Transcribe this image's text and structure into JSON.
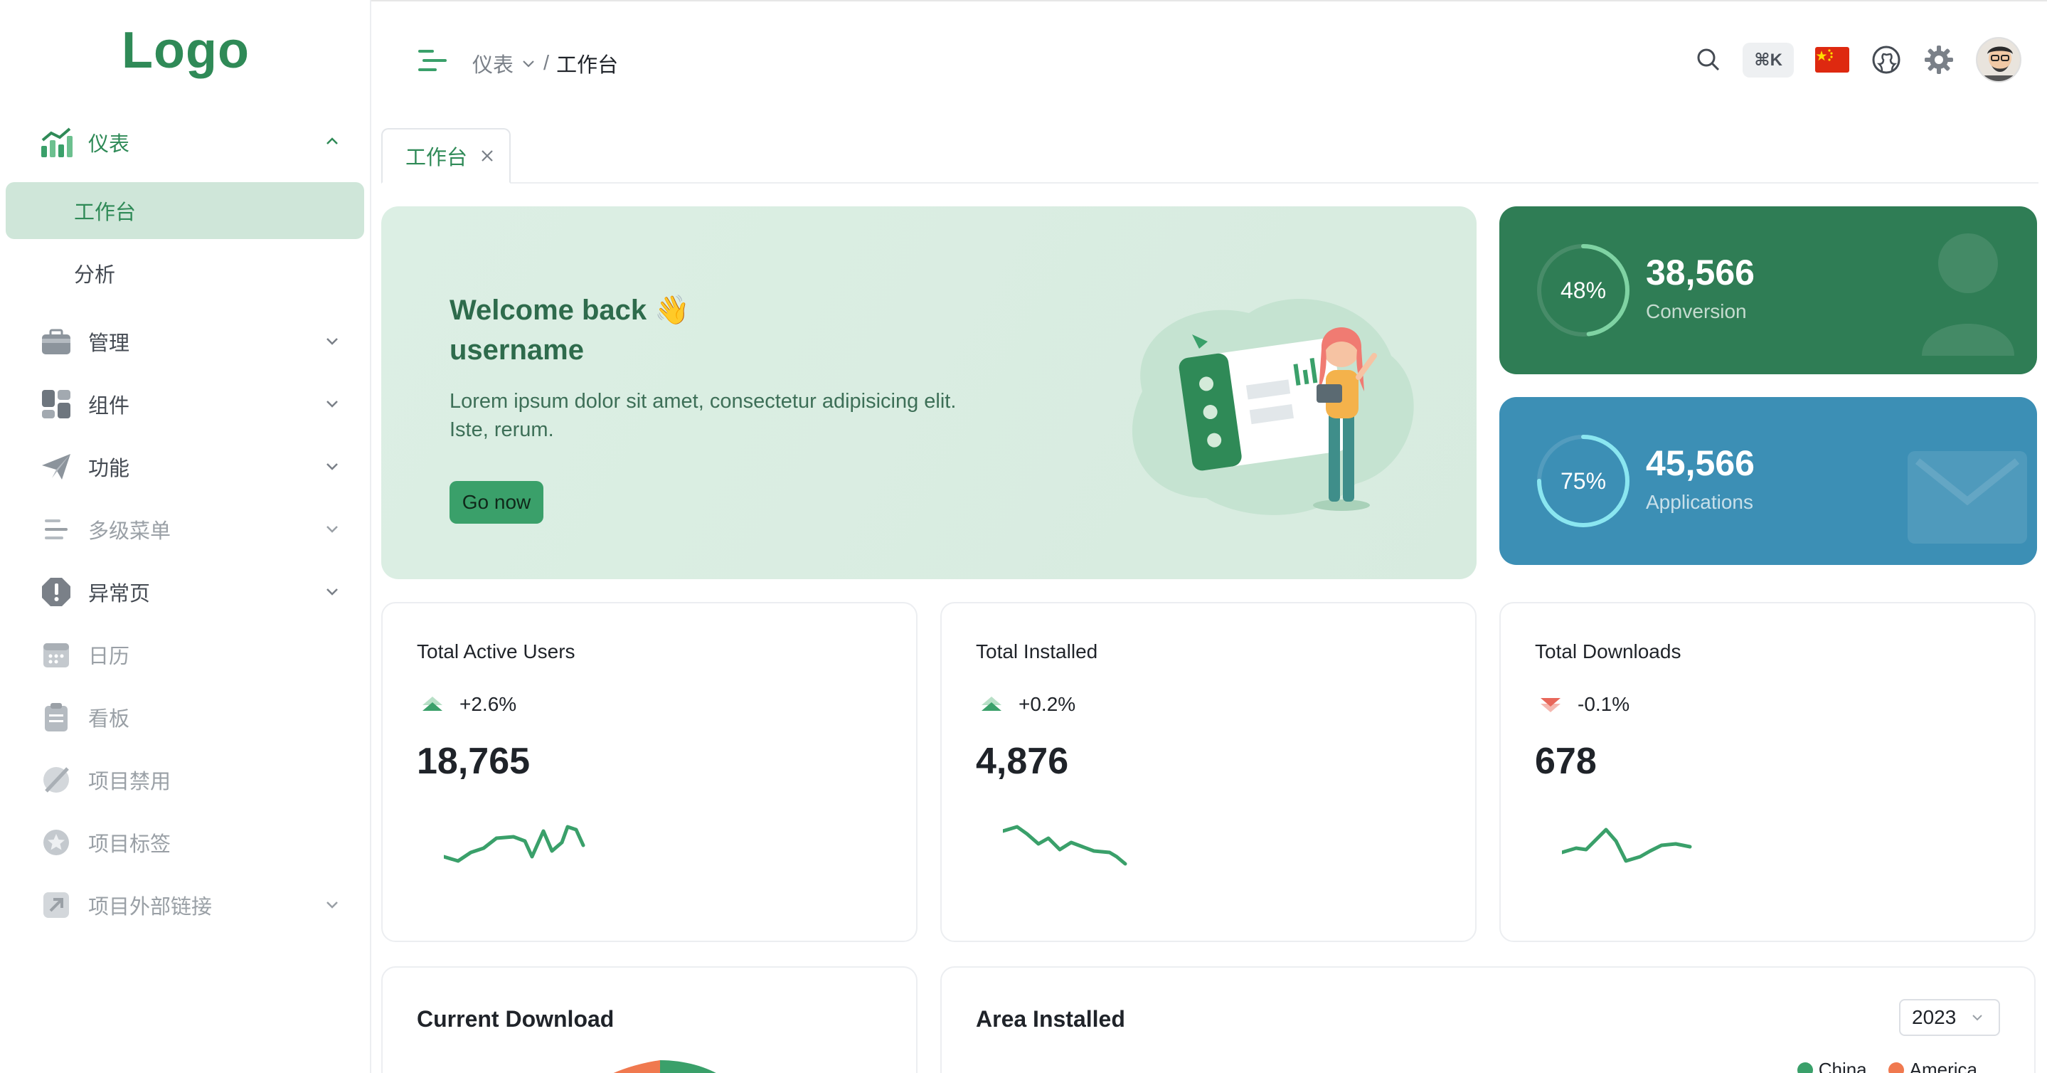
{
  "logo": "Logo",
  "sidebar": {
    "items": [
      {
        "label": "仪表",
        "icon": "chart-icon"
      },
      {
        "label": "工作台"
      },
      {
        "label": "分析"
      },
      {
        "label": "管理",
        "icon": "briefcase-icon"
      },
      {
        "label": "组件",
        "icon": "widgets-icon"
      },
      {
        "label": "功能",
        "icon": "paper-plane-icon"
      },
      {
        "label": "多级菜单",
        "icon": "multilevel-menu-icon"
      },
      {
        "label": "异常页",
        "icon": "alert-icon"
      },
      {
        "label": "日历",
        "icon": "calendar-icon"
      },
      {
        "label": "看板",
        "icon": "clipboard-icon"
      },
      {
        "label": "项目禁用",
        "icon": "disabled-icon"
      },
      {
        "label": "项目标签",
        "icon": "star-badge-icon"
      },
      {
        "label": "项目外部链接",
        "icon": "external-link-icon"
      }
    ]
  },
  "header": {
    "breadcrumb": {
      "parent": "仪表",
      "separator": "/",
      "current": "工作台"
    },
    "shortcut": "⌘K"
  },
  "tabs": [
    {
      "label": "工作台"
    }
  ],
  "welcome": {
    "title_line1": "Welcome back 👋",
    "title_line2": "username",
    "text": "Lorem ipsum dolor sit amet, consectetur adipisicing elit. Iste, rerum.",
    "button": "Go now"
  },
  "stats": [
    {
      "percent": "48%",
      "percent_value": 0.48,
      "value": "38,566",
      "label": "Conversion",
      "color": "#2f7d55"
    },
    {
      "percent": "75%",
      "percent_value": 0.75,
      "value": "45,566",
      "label": "Applications",
      "color": "#3c8fb5"
    }
  ],
  "kpis": [
    {
      "title": "Total Active Users",
      "trend": "+2.6%",
      "direction": "up",
      "value": "18,765"
    },
    {
      "title": "Total Installed",
      "trend": "+0.2%",
      "direction": "up",
      "value": "4,876"
    },
    {
      "title": "Total Downloads",
      "trend": "-0.1%",
      "direction": "down",
      "value": "678"
    }
  ],
  "bottom": {
    "current_download": {
      "title": "Current Download"
    },
    "area_installed": {
      "title": "Area Installed",
      "year": "2023",
      "legend": [
        {
          "label": "China",
          "color": "#3aa06a"
        },
        {
          "label": "America",
          "color": "#f0794f"
        }
      ]
    }
  },
  "colors": {
    "accent": "#2f8a57",
    "active_bg": "#cfe6d9",
    "down": "#e8675a"
  }
}
